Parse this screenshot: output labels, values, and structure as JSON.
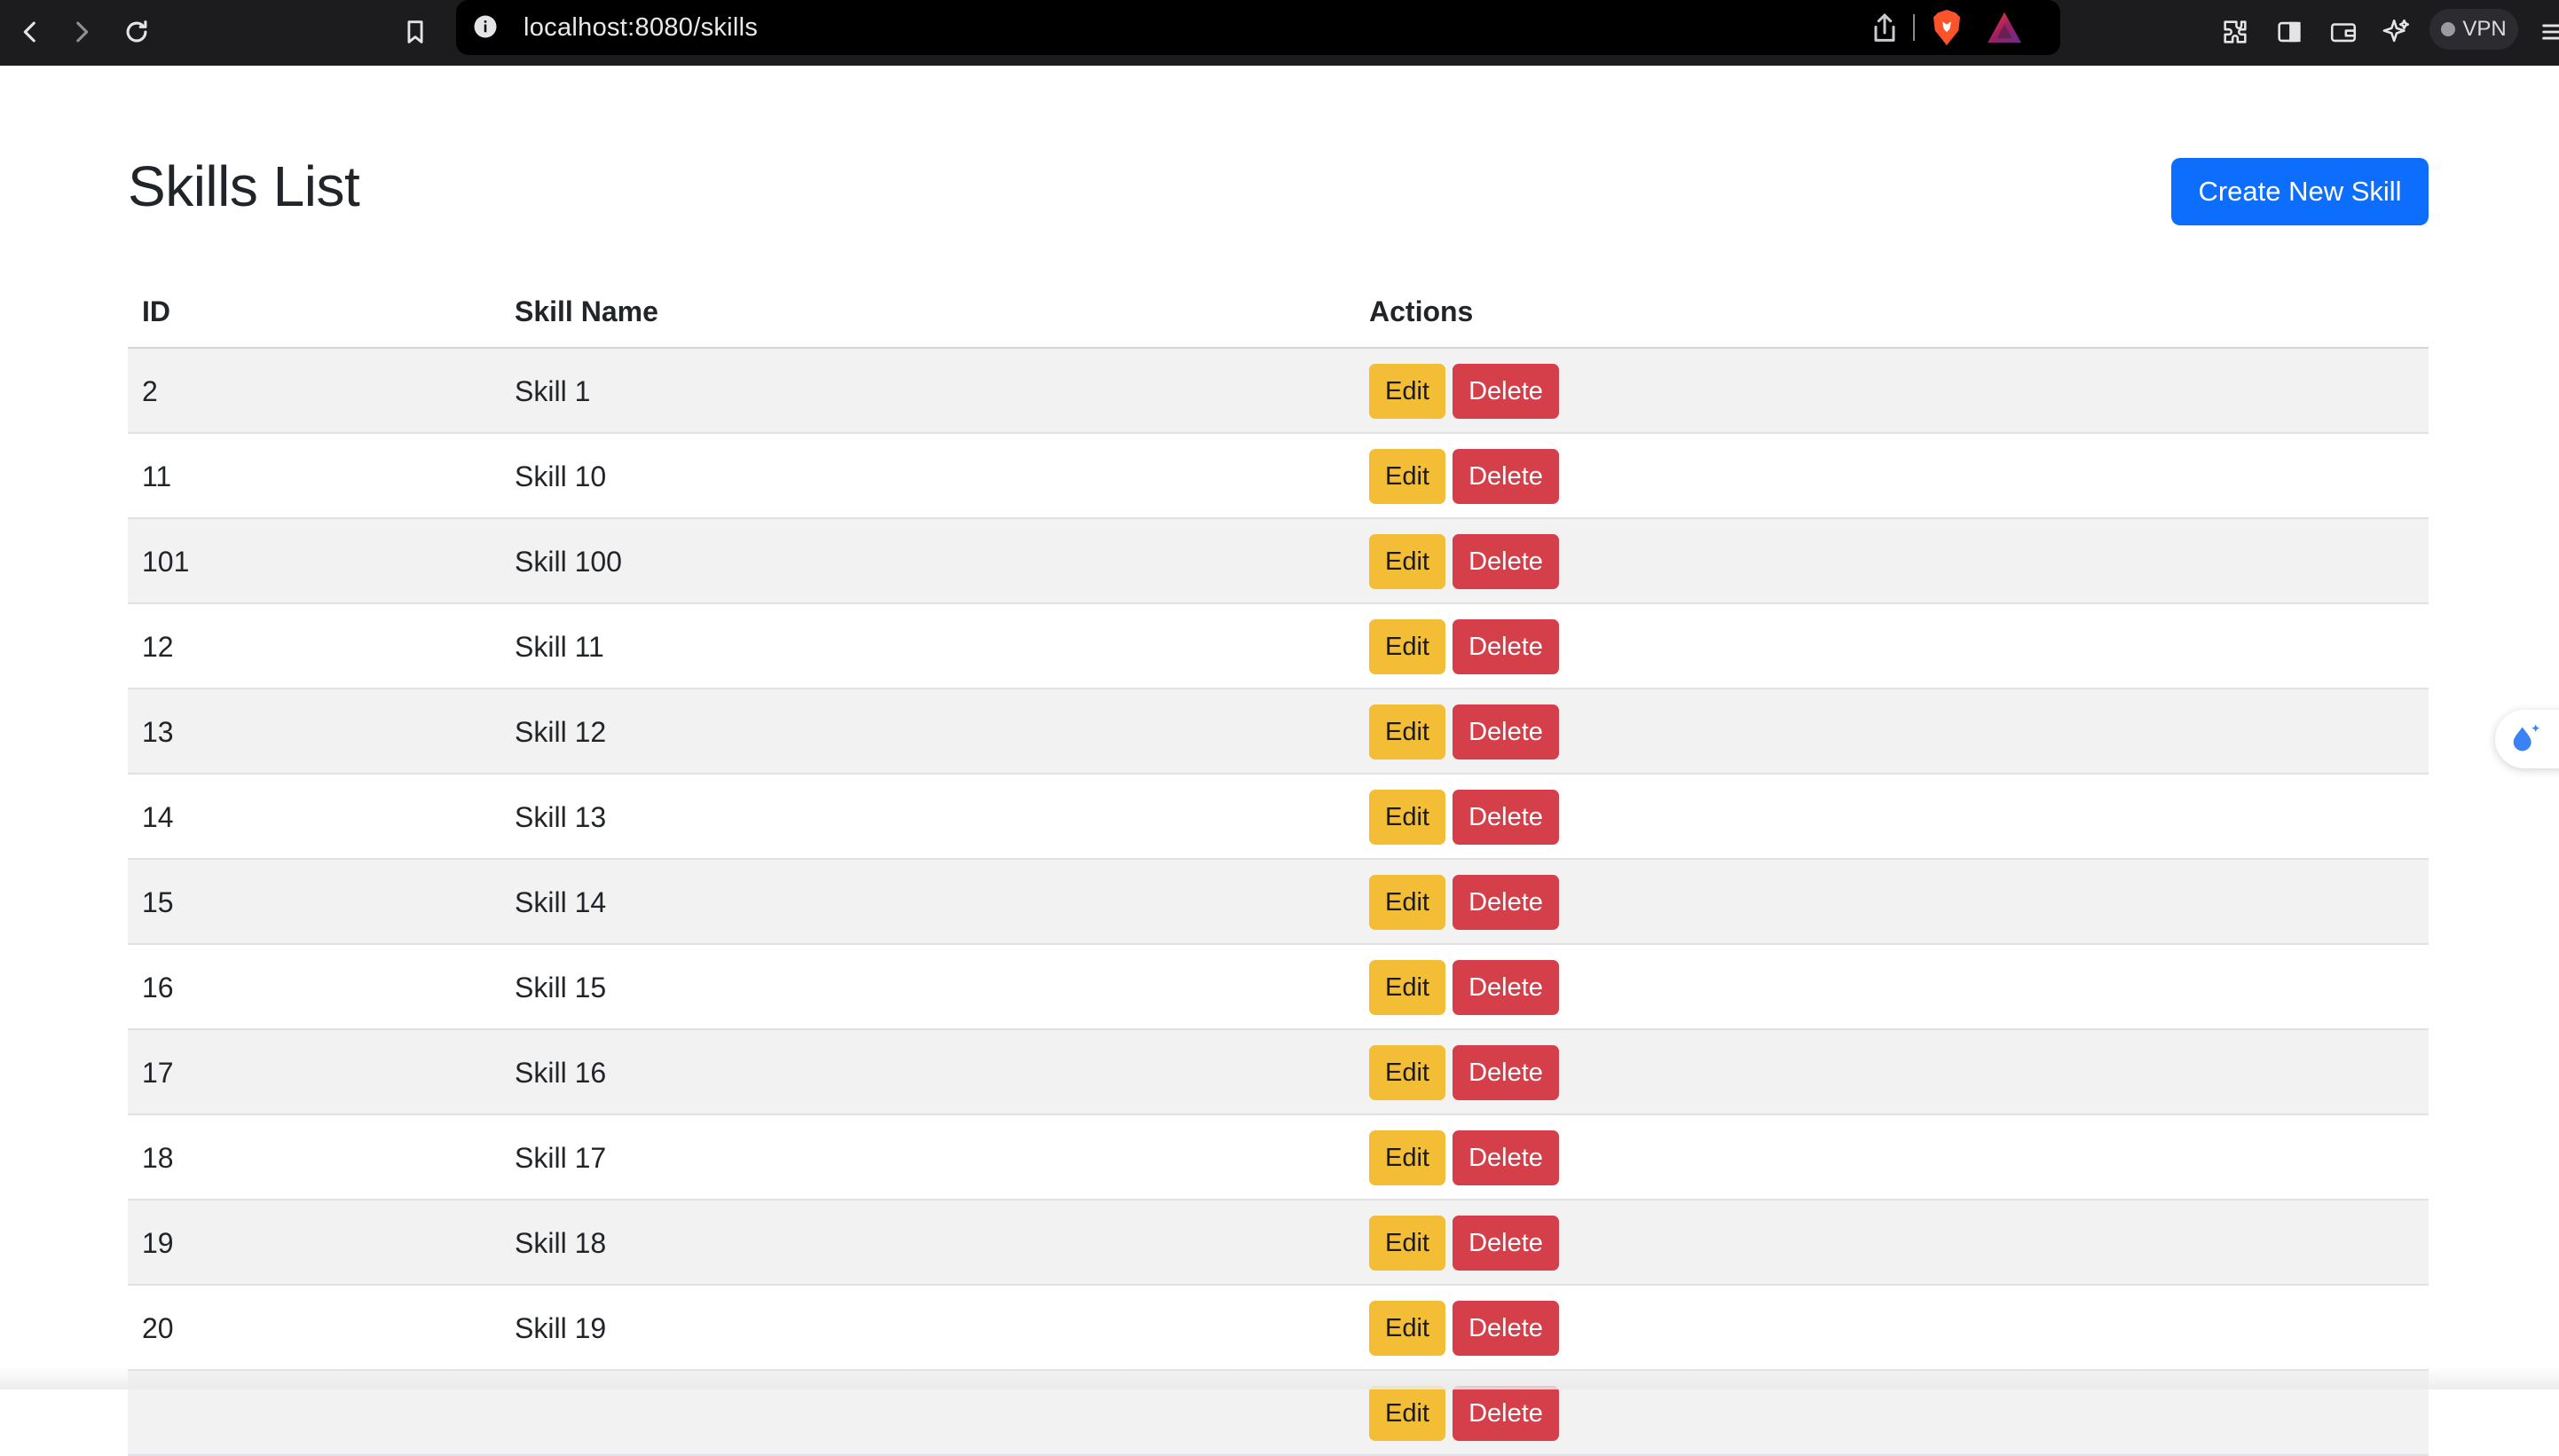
{
  "browser": {
    "url": "localhost:8080/skills",
    "vpn_label": "VPN"
  },
  "page": {
    "title": "Skills List",
    "create_button": "Create New Skill"
  },
  "table": {
    "headers": {
      "id": "ID",
      "name": "Skill Name",
      "actions": "Actions"
    },
    "edit_label": "Edit",
    "delete_label": "Delete",
    "rows": [
      {
        "id": "2",
        "name": "Skill 1"
      },
      {
        "id": "11",
        "name": "Skill 10"
      },
      {
        "id": "101",
        "name": "Skill 100"
      },
      {
        "id": "12",
        "name": "Skill 11"
      },
      {
        "id": "13",
        "name": "Skill 12"
      },
      {
        "id": "14",
        "name": "Skill 13"
      },
      {
        "id": "15",
        "name": "Skill 14"
      },
      {
        "id": "16",
        "name": "Skill 15"
      },
      {
        "id": "17",
        "name": "Skill 16"
      },
      {
        "id": "18",
        "name": "Skill 17"
      },
      {
        "id": "19",
        "name": "Skill 18"
      },
      {
        "id": "20",
        "name": "Skill 19"
      },
      {
        "id": "",
        "name": ""
      }
    ]
  },
  "colors": {
    "primary": "#0d6efd",
    "warning": "#f3bd35",
    "danger": "#d43f4a",
    "stripe": "#f2f2f2"
  },
  "icons": [
    "back-icon",
    "forward-icon",
    "reload-icon",
    "bookmark-icon",
    "info-icon",
    "share-icon",
    "brave-shield-icon",
    "brave-rewards-icon",
    "extensions-icon",
    "sidebar-icon",
    "wallet-icon",
    "leo-ai-icon",
    "menu-icon"
  ]
}
